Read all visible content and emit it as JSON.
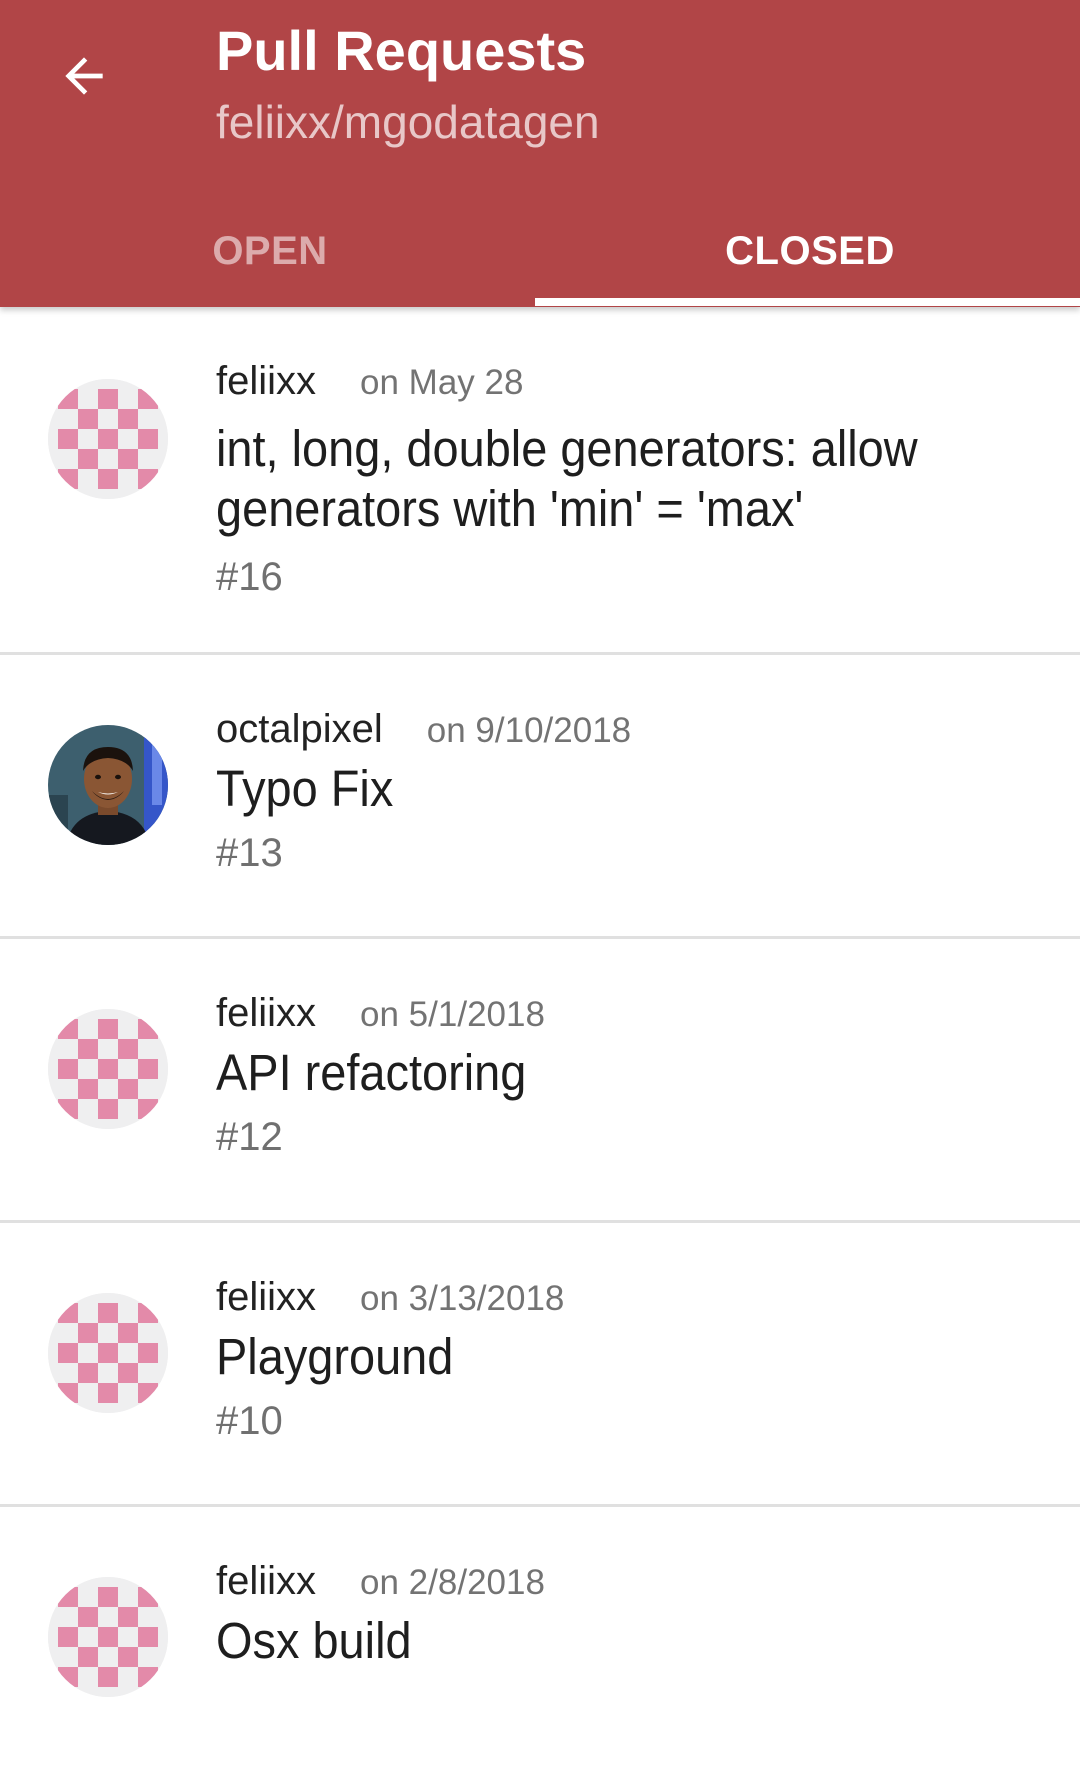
{
  "header": {
    "title": "Pull Requests",
    "subtitle": "feliixx/mgodatagen",
    "back_icon": "arrow-back-icon",
    "background_color": "#b14547"
  },
  "tabs": [
    {
      "label": "OPEN",
      "selected": false
    },
    {
      "label": "CLOSED",
      "selected": true
    }
  ],
  "pull_requests": [
    {
      "author": "feliixx",
      "date": "on May 28",
      "title": "int, long, double generators: allow generators with 'min' = 'max'",
      "number": "#16",
      "avatar": "identicon"
    },
    {
      "author": "octalpixel",
      "date": "on 9/10/2018",
      "title": "Typo Fix",
      "number": "#13",
      "avatar": "photo"
    },
    {
      "author": "feliixx",
      "date": "on 5/1/2018",
      "title": "API refactoring",
      "number": "#12",
      "avatar": "identicon"
    },
    {
      "author": "feliixx",
      "date": "on 3/13/2018",
      "title": "Playground",
      "number": "#10",
      "avatar": "identicon"
    },
    {
      "author": "feliixx",
      "date": "on 2/8/2018",
      "title": "Osx build",
      "number": "",
      "avatar": "identicon"
    }
  ]
}
